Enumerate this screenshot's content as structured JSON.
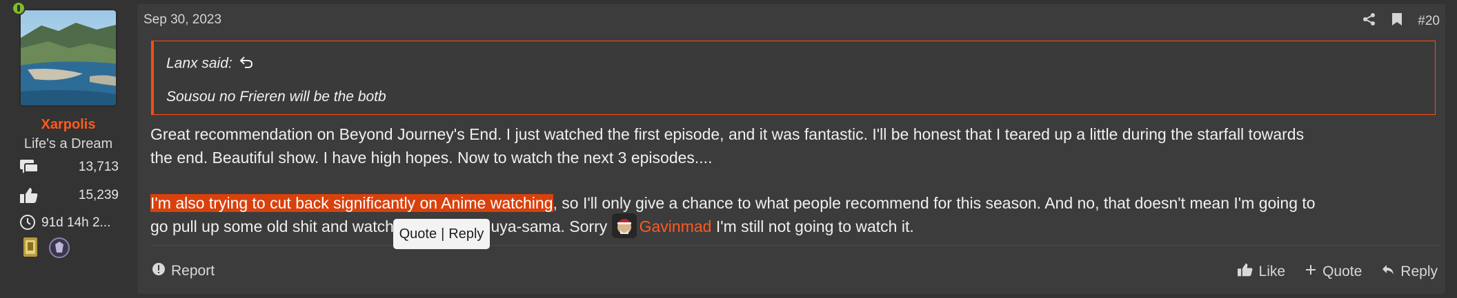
{
  "user": {
    "name": "Xarpolis",
    "title": "Life's a Dream",
    "messages": "13,713",
    "reactions": "15,239",
    "time": "91d 14h 2..."
  },
  "post": {
    "date": "Sep 30, 2023",
    "number": "#20",
    "quote": {
      "attribution": "Lanx said:",
      "text": "Sousou no Frieren will be the botb"
    },
    "paragraph1": {
      "line1": "Great recommendation on Beyond Journey's End. I just watched the first episode, and it was fantastic. I'll be honest that I teared up a little during the starfall towards",
      "line2": "the end. Beautiful show. I have high hopes. Now to watch the next 3 episodes...."
    },
    "paragraph2": {
      "highlight": "I'm also trying to cut back significantly on Anime watching",
      "rest1": ", so I'll only give a chance to what people recommend for this season. And no, that doesn't mean I'm going to",
      "line2_start": "go pull up some old shit and watch that. IE - Kaguya-sama. Sorry ",
      "mention": "Gavinmad",
      "line2_end": " I'm still not going to watch it."
    },
    "tooltip": {
      "quote": "Quote",
      "separator": "|",
      "reply": "Reply"
    },
    "actions": {
      "report": "Report",
      "like": "Like",
      "quote": "Quote",
      "reply": "Reply"
    }
  },
  "colors": {
    "accent": "#ff5a1f",
    "highlight": "#d9410c",
    "background": "#333333",
    "panel": "#3c3c3c"
  },
  "icons": [
    "share-icon",
    "bookmark-icon",
    "reply-arrow-icon",
    "messages-icon",
    "thumbs-up-icon",
    "clock-icon",
    "alert-icon",
    "plus-icon"
  ]
}
